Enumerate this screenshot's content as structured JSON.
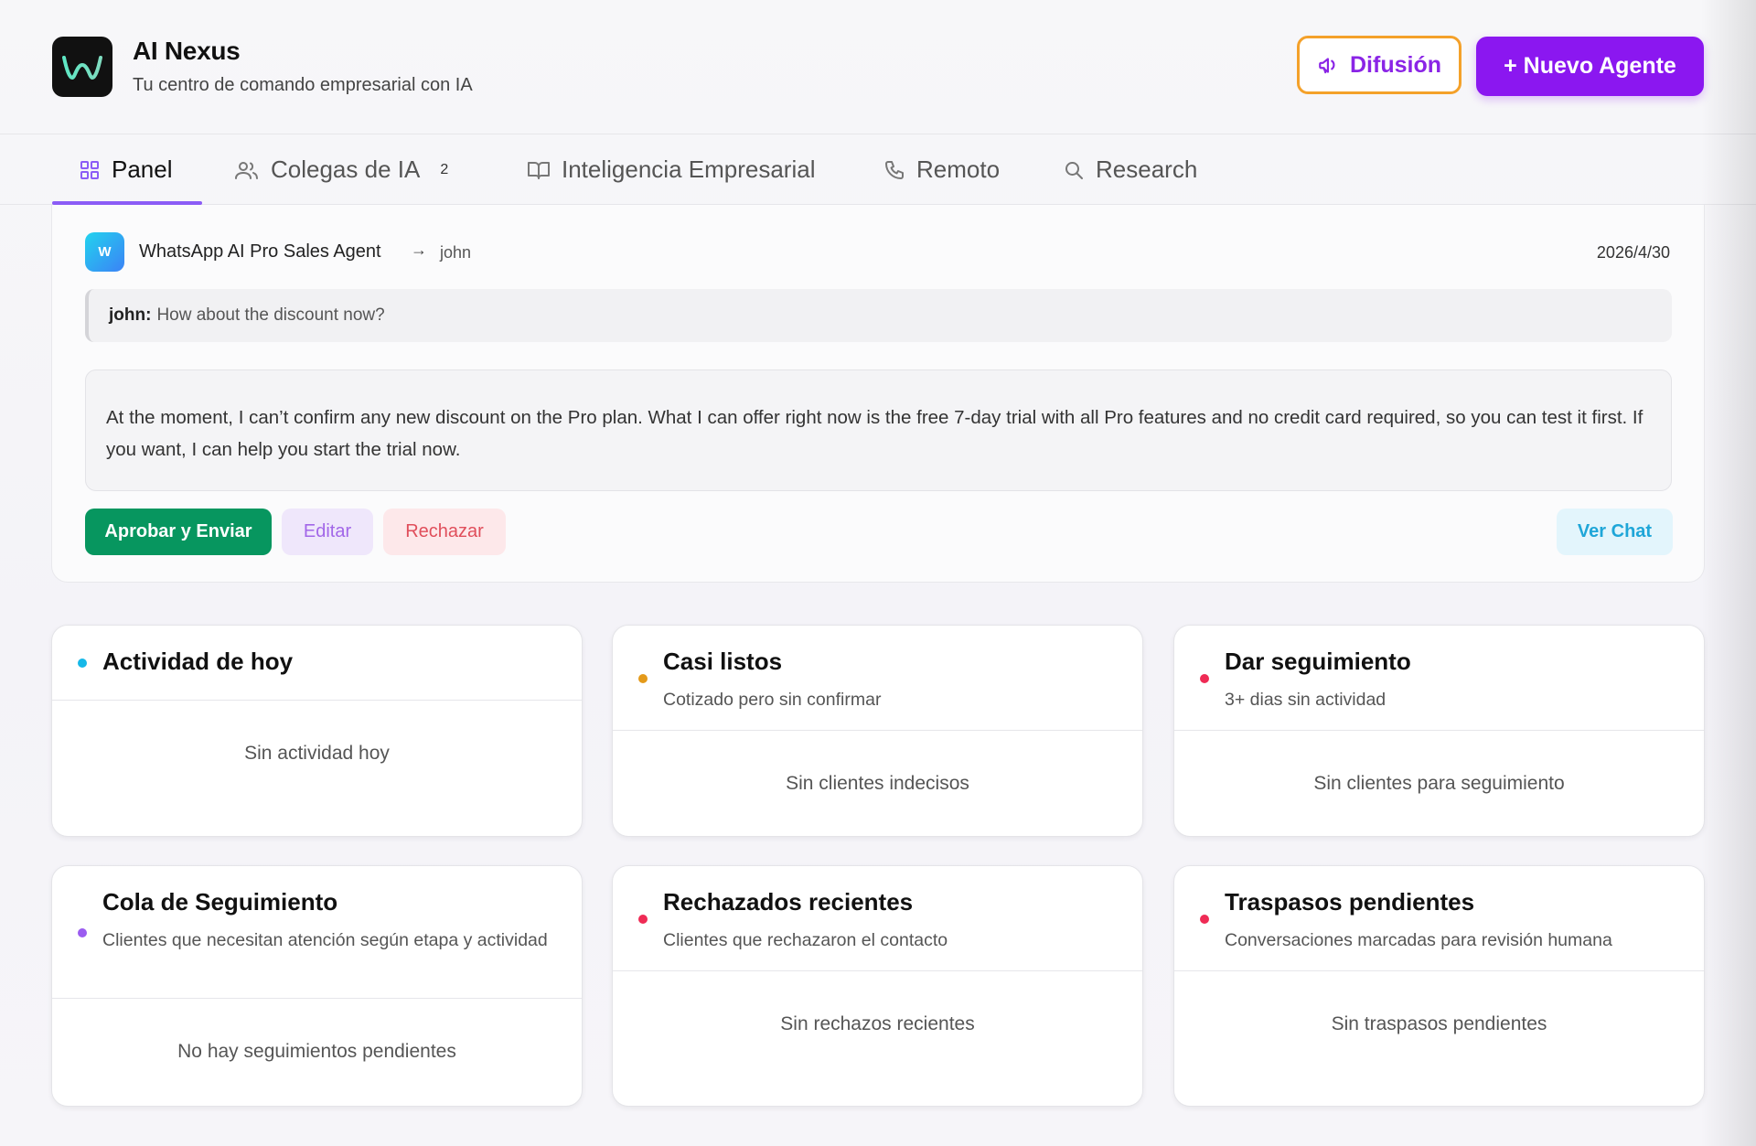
{
  "app": {
    "title": "AI Nexus",
    "subtitle": "Tu centro de comando empresarial con IA",
    "logo_icon": "waveform-w-icon",
    "accent": "#8b17f0"
  },
  "header_actions": {
    "broadcast_label": "Difusión",
    "new_agent_label": "+ Nuevo Agente"
  },
  "tabs": [
    {
      "label": "Panel",
      "icon": "grid-icon",
      "active": true
    },
    {
      "label": "Colegas de IA",
      "icon": "users-icon",
      "badge": "2"
    },
    {
      "label": "Inteligencia Empresarial",
      "icon": "book-icon"
    },
    {
      "label": "Remoto",
      "icon": "phone-icon"
    },
    {
      "label": "Research",
      "icon": "search-icon"
    }
  ],
  "approval": {
    "agent_initial": "W",
    "agent_name": "WhatsApp AI Pro Sales Agent",
    "arrow": "→",
    "recipient": "john",
    "date": "2026/4/30",
    "incoming_sender": "john:",
    "incoming_text": "How about the discount now?",
    "draft_reply": "At the moment, I can’t confirm any new discount on the Pro plan. What I can offer right now is the free 7-day trial with all Pro features and no credit card required, so you can test it first. If you want, I can help you start the trial now.",
    "approve_label": "Aprobar y Enviar",
    "edit_label": "Editar",
    "reject_label": "Rechazar",
    "view_chat_label": "Ver Chat"
  },
  "cards": [
    {
      "title": "Actividad de hoy",
      "subtitle": "",
      "empty": "Sin actividad hoy",
      "dot_color": "#16b8e8"
    },
    {
      "title": "Casi listos",
      "subtitle": "Cotizado pero sin confirmar",
      "empty": "Sin clientes indecisos",
      "dot_color": "#e49a1a"
    },
    {
      "title": "Dar seguimiento",
      "subtitle": "3+ dias sin actividad",
      "empty": "Sin clientes para seguimiento",
      "dot_color": "#ef2b55"
    },
    {
      "title": "Cola de Seguimiento",
      "subtitle": "Clientes que necesitan atención según etapa y actividad",
      "empty": "No hay seguimientos pendientes",
      "dot_color": "#9b5cf0"
    },
    {
      "title": "Rechazados recientes",
      "subtitle": "Clientes que rechazaron el contacto",
      "empty": "Sin rechazos recientes",
      "dot_color": "#ef2b55"
    },
    {
      "title": "Traspasos pendientes",
      "subtitle": "Conversaciones marcadas para revisión humana",
      "empty": "Sin traspasos pendientes",
      "dot_color": "#ef2b55"
    }
  ]
}
